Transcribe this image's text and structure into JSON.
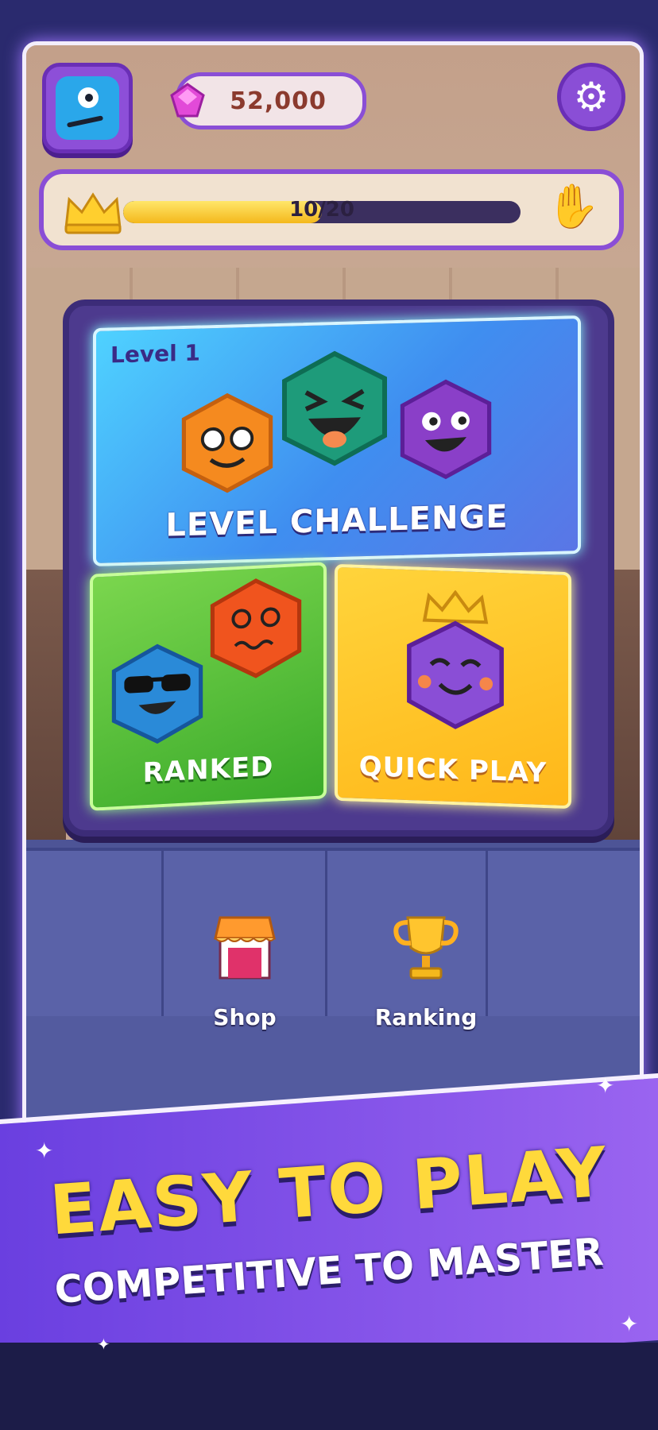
{
  "header": {
    "gems": "52,000"
  },
  "progress": {
    "text": "10/20",
    "fraction": 0.5
  },
  "modes": {
    "level": {
      "level_label": "Level 1",
      "title": "LEVEL CHALLENGE"
    },
    "ranked": {
      "title": "RANKED"
    },
    "quick": {
      "title": "QUICK PLAY"
    }
  },
  "bottom_nav": {
    "shop": "Shop",
    "ranking": "Ranking"
  },
  "promo": {
    "headline": "EASY TO PLAY",
    "subline": "COMPETITIVE TO MASTER"
  },
  "colors": {
    "accent": "#8a4ed6",
    "headline": "#ffd93b"
  }
}
